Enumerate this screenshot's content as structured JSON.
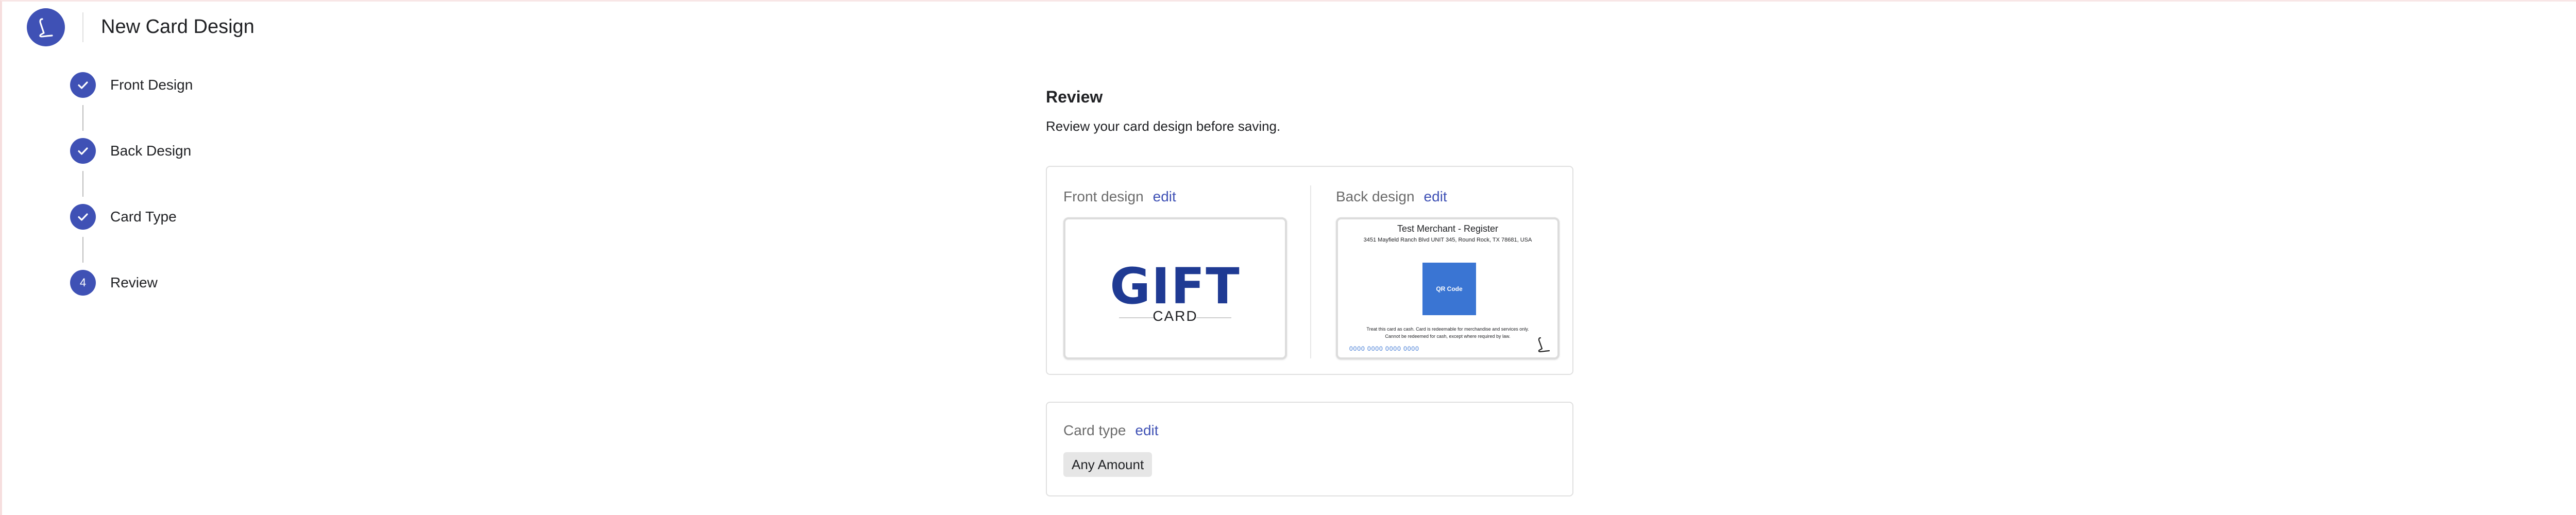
{
  "header": {
    "title": "New Card Design",
    "logo_icon": "brand-logo-icon",
    "close_icon": "close-icon"
  },
  "stepper": {
    "steps": [
      {
        "label": "Front Design",
        "state": "completed",
        "icon": "check-icon"
      },
      {
        "label": "Back Design",
        "state": "completed",
        "icon": "check-icon"
      },
      {
        "label": "Card Type",
        "state": "completed",
        "icon": "check-icon"
      },
      {
        "label": "Review",
        "state": "active",
        "number": "4"
      }
    ]
  },
  "review": {
    "title": "Review",
    "subtitle": "Review your card design before saving.",
    "front": {
      "label": "Front design",
      "edit_label": "edit",
      "preview": {
        "gift_text": "GIFT",
        "card_text": "CARD"
      }
    },
    "back": {
      "label": "Back design",
      "edit_label": "edit",
      "preview": {
        "merchant": "Test Merchant - Register",
        "address": "3451 Mayfield Ranch Blvd UNIT 345, Round Rock, TX 78681, USA",
        "qr_label": "QR Code",
        "terms_line1": "Treat this card as cash. Card is redeemable for merchandise and services only.",
        "terms_line2": "Cannot be redeemed for cash, except where required by law.",
        "card_number": "0000  0000  0000  0000"
      }
    },
    "card_type": {
      "label": "Card type",
      "edit_label": "edit",
      "value": "Any Amount"
    }
  },
  "colors": {
    "accent": "#3f51b5",
    "link": "#3f51b5",
    "gift_text": "#1f3a93",
    "qr_fill": "#3a75d3",
    "chip_bg": "#e6e6e6",
    "border": "#e0e0e0"
  }
}
